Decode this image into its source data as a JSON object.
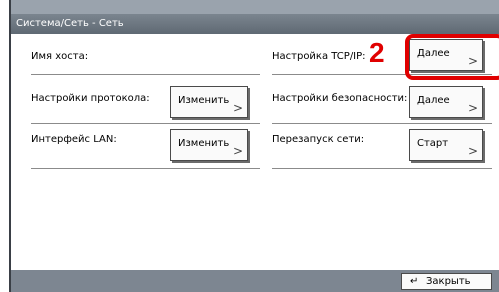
{
  "window": {
    "title": "Система/Сеть - Сеть"
  },
  "step_number": "2",
  "settings": {
    "hostname_label": "Имя хоста:",
    "tcpip_label": "Настройка TCP/IP:",
    "tcpip_button": "Далее",
    "protocol_label": "Настройки протокола:",
    "protocol_button": "Изменить",
    "security_label": "Настройки безопасности:",
    "security_button": "Далее",
    "lan_label": "Интерфейс LAN:",
    "lan_button": "Изменить",
    "restart_label": "Перезапуск сети:",
    "restart_button": "Старт"
  },
  "footer": {
    "close_label": "Закрыть",
    "close_icon": "return-arrow-icon"
  },
  "colors": {
    "highlight": "#e00000",
    "titlebar": "#6a747e"
  }
}
